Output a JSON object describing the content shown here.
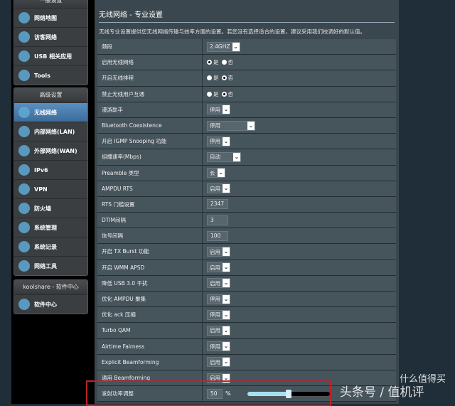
{
  "sidebar": {
    "general_header": "一般设置",
    "general": [
      "网络地图",
      "访客网络",
      "USB 相关应用",
      "Tools"
    ],
    "advanced_header": "高级设置",
    "advanced": [
      "无线网络",
      "内部网络(LAN)",
      "外部网络(WAN)",
      "IPv6",
      "VPN",
      "防火墙",
      "系统管理",
      "系统记录",
      "网络工具"
    ],
    "koolshare_header": "koolshare - 软件中心",
    "koolshare": [
      "软件中心"
    ]
  },
  "main": {
    "title": "无线网络 - 专业设置",
    "description": "无线专业设置提供您无线网络传输与效率方面的设置。若您没有选择适合的设置，建议采用我们校调好的默认值。",
    "yes": "是",
    "no": "否",
    "percent": "%",
    "rows": [
      {
        "label": "频段",
        "type": "select",
        "value": "2.4GHZ"
      },
      {
        "label": "启用无线网络",
        "type": "radio",
        "value": "yes"
      },
      {
        "label": "开启无线排程",
        "type": "radio",
        "value": "no"
      },
      {
        "label": "禁止无线用户互通",
        "type": "radio",
        "value": "no"
      },
      {
        "label": "漫游助手",
        "type": "select",
        "value": "停用"
      },
      {
        "label": "Bluetooth Coexistence",
        "type": "select",
        "value": "停用",
        "wide": true
      },
      {
        "label": "开启 IGMP Snooping 功能",
        "type": "select",
        "value": "停用"
      },
      {
        "label": "组播速率(Mbps)",
        "type": "select",
        "value": "自动",
        "mid": true
      },
      {
        "label": "Preamble 类型",
        "type": "select",
        "value": "长"
      },
      {
        "label": "AMPDU RTS",
        "type": "select",
        "value": "启用"
      },
      {
        "label": "RTS 门槛设置",
        "type": "text",
        "value": "2347"
      },
      {
        "label": "DTIM间隔",
        "type": "text",
        "value": "3"
      },
      {
        "label": "信号间隔",
        "type": "text",
        "value": "100"
      },
      {
        "label": "开启 TX Burst 功能",
        "type": "select",
        "value": "启用"
      },
      {
        "label": "开启 WMM APSD",
        "type": "select",
        "value": "启用"
      },
      {
        "label": "降低 USB 3.0 干扰",
        "type": "select",
        "value": "启用"
      },
      {
        "label": "优化 AMPDU 聚集",
        "type": "select",
        "value": "停用"
      },
      {
        "label": "优化 ack 压缩",
        "type": "select",
        "value": "停用"
      },
      {
        "label": "Turbo QAM",
        "type": "select",
        "value": "启用"
      },
      {
        "label": "Airtime Fairness",
        "type": "select",
        "value": "停用"
      },
      {
        "label": "Explicit Beamforming",
        "type": "select",
        "value": "启用"
      },
      {
        "label": "通用 Beamforming",
        "type": "select",
        "value": "启用"
      },
      {
        "label": "发射功率调整",
        "type": "slider",
        "value": "50"
      }
    ]
  },
  "watermark": {
    "line1": "头条号 / 值机评",
    "line2": "什么值得买"
  },
  "colors": {
    "active": "#4a7eb0",
    "highlight": "#c0232b"
  }
}
